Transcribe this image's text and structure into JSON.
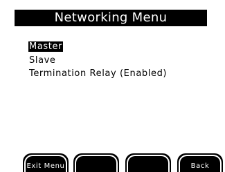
{
  "title": "Networking Menu",
  "menu": {
    "items": [
      {
        "label": "Master",
        "selected": true
      },
      {
        "label": "Slave",
        "selected": false
      },
      {
        "label": "Termination Relay (Enabled)",
        "selected": false
      }
    ]
  },
  "softkeys": {
    "key1": "Exit Menu",
    "key2": "",
    "key3": "",
    "key4": "Back"
  },
  "colors": {
    "background": "#ffffff",
    "foreground": "#000000",
    "inverse": "#ffffff"
  }
}
